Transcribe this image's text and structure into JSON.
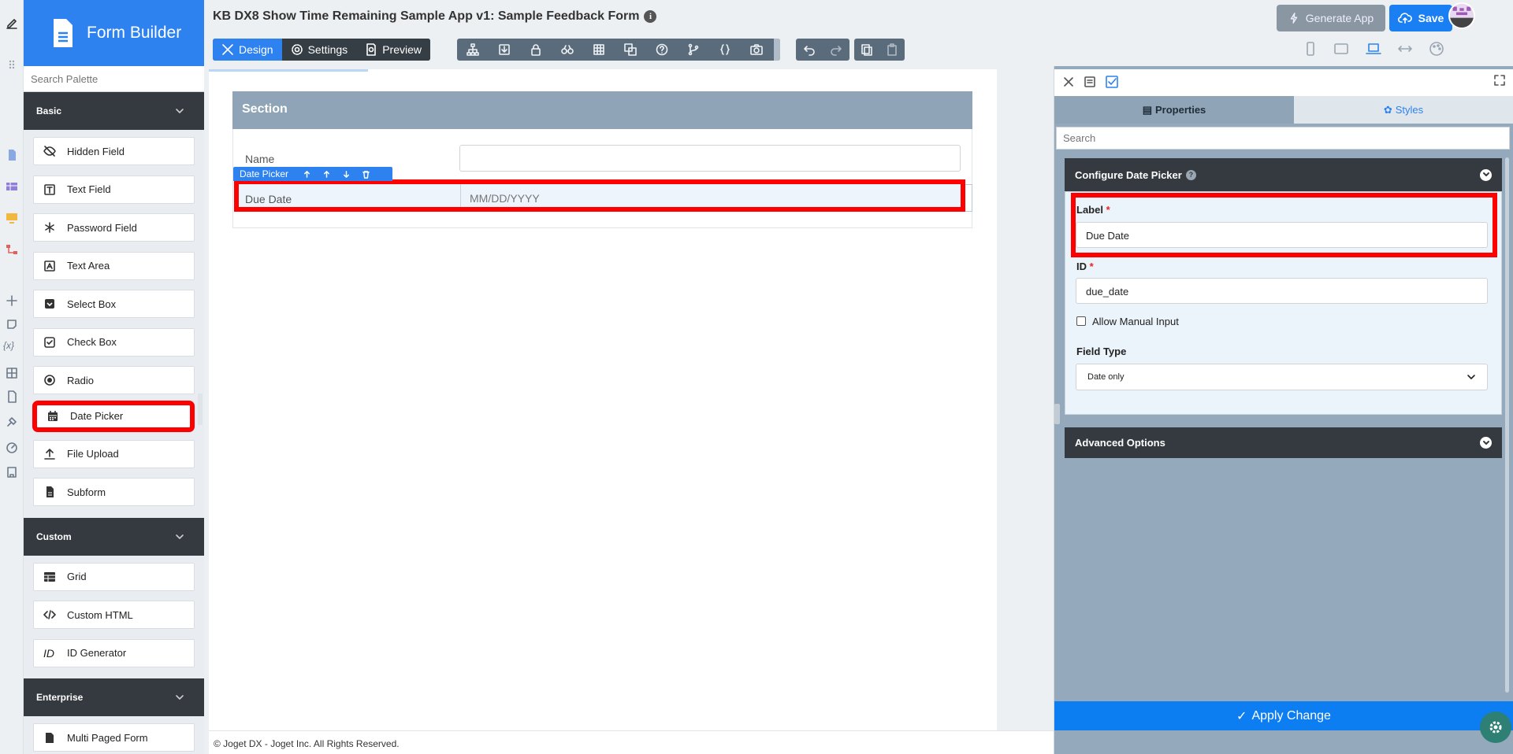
{
  "app": {
    "brand": "Form Builder",
    "title": "KB DX8 Show Time Remaining Sample App v1: Sample Feedback Form",
    "info_glyph": "i"
  },
  "header": {
    "modes": [
      "Design",
      "Settings",
      "Preview"
    ],
    "generate_label": "Generate App",
    "save_label": "Save"
  },
  "palette": {
    "search_placeholder": "Search Palette",
    "categories": [
      {
        "label": "Basic",
        "items": [
          "Hidden Field",
          "Text Field",
          "Password Field",
          "Text Area",
          "Select Box",
          "Check Box",
          "Radio",
          "Date Picker",
          "File Upload",
          "Subform"
        ]
      },
      {
        "label": "Custom",
        "items": [
          "Grid",
          "Custom HTML",
          "ID Generator"
        ]
      },
      {
        "label": "Enterprise",
        "items": [
          "Multi Paged Form"
        ]
      }
    ]
  },
  "canvas": {
    "section_title": "Section",
    "fields": [
      {
        "label": "Name",
        "placeholder": ""
      },
      {
        "label": "Due Date",
        "placeholder": "MM/DD/YYYY"
      }
    ],
    "selected_type": "Date Picker",
    "footer": "© Joget DX - Joget Inc. All Rights Reserved."
  },
  "properties": {
    "tabs": [
      "Properties",
      "Styles"
    ],
    "search_placeholder": "Search",
    "section_title": "Configure Date Picker",
    "label_label": "Label",
    "label_value": "Due Date",
    "id_label": "ID",
    "id_value": "due_date",
    "required_mark": "*",
    "allow_manual": "Allow Manual Input",
    "field_type_label": "Field Type",
    "field_type_value": "Date only",
    "advanced": "Advanced Options",
    "apply": "Apply Change"
  },
  "colors": {
    "primary": "#2d82f0",
    "highlight": "#ff0000",
    "dark": "#343a40"
  }
}
